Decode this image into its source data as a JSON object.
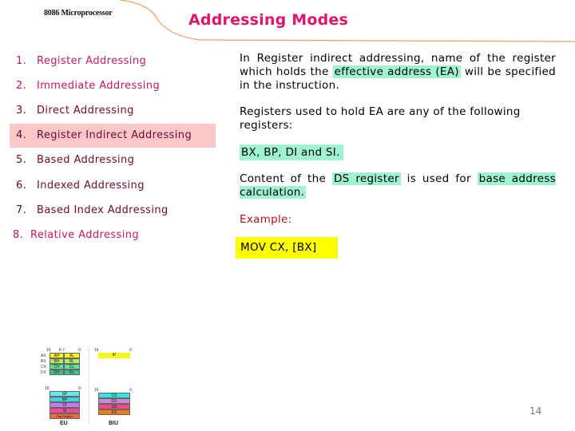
{
  "header": {
    "course_label": "8086 Microprocessor",
    "title": "Addressing Modes"
  },
  "modes": [
    {
      "num": "1.",
      "label": "Register Addressing",
      "style": "pink"
    },
    {
      "num": "2.",
      "label": "Immediate Addressing",
      "style": "pink"
    },
    {
      "num": "3.",
      "label": "Direct Addressing",
      "style": "dark"
    },
    {
      "num": "4.",
      "label": "Register Indirect Addressing",
      "style": "dark",
      "active": true
    },
    {
      "num": "5.",
      "label": "Based Addressing",
      "style": "dark"
    },
    {
      "num": "6.",
      "label": "Indexed Addressing",
      "style": "dark"
    },
    {
      "num": "7.",
      "label": "Based Index Addressing",
      "style": "dark"
    },
    {
      "num": "8.",
      "label": "Relative Addressing",
      "style": "pink"
    }
  ],
  "content": {
    "para1_a": "In Register indirect addressing, name of the register which holds the ",
    "para1_hl": "effective address (EA)",
    "para1_b": " will be specified in the instruction.",
    "para2": "Registers used to hold EA are any of the following registers:",
    "registers_hl": "BX, BP, DI and SI.",
    "para3_a": "Content of the ",
    "para3_hl1": "DS register",
    "para3_b": " is used for ",
    "para3_hl2": "base address calculation.",
    "example_label": "Example:",
    "example_code": "MOV CX, [BX]"
  },
  "register_diagram": {
    "bits_eu_top": [
      "15",
      "8 7",
      "0"
    ],
    "bits_biu_top": [
      "16",
      "0"
    ],
    "general": [
      {
        "name": "AX",
        "high": "AH",
        "low": "AL",
        "color": "#f5f51e"
      },
      {
        "name": "BX",
        "high": "BH",
        "low": "BL",
        "color": "#b8ee5c"
      },
      {
        "name": "CX",
        "high": "CH",
        "low": "CL",
        "color": "#5fe3a0"
      },
      {
        "name": "DX",
        "high": "DH",
        "low": "DL",
        "color": "#3fbf8a"
      }
    ],
    "ip": {
      "label": "IP",
      "color": "#f5f51e"
    },
    "bits_eu_bottom": [
      "15",
      "0"
    ],
    "pointer_index": [
      {
        "label": "SP",
        "color": "#66e9e9"
      },
      {
        "label": "BP",
        "color": "#3fd3d3"
      },
      {
        "label": "DI",
        "color": "#c67bf0"
      },
      {
        "label": "SI",
        "color": "#ec4f95"
      },
      {
        "label": "Flag Register",
        "color": "#f06a3a"
      }
    ],
    "bits_biu_bottom": [
      "16",
      "0"
    ],
    "segment": [
      {
        "label": "CS",
        "color": "#33e5e5"
      },
      {
        "label": "DS",
        "color": "#c98ad4"
      },
      {
        "label": "SS",
        "color": "#ef4b85"
      },
      {
        "label": "ES",
        "color": "#f47a1e"
      }
    ],
    "eu_label": "EU",
    "biu_label": "BIU"
  },
  "page_number": "14"
}
